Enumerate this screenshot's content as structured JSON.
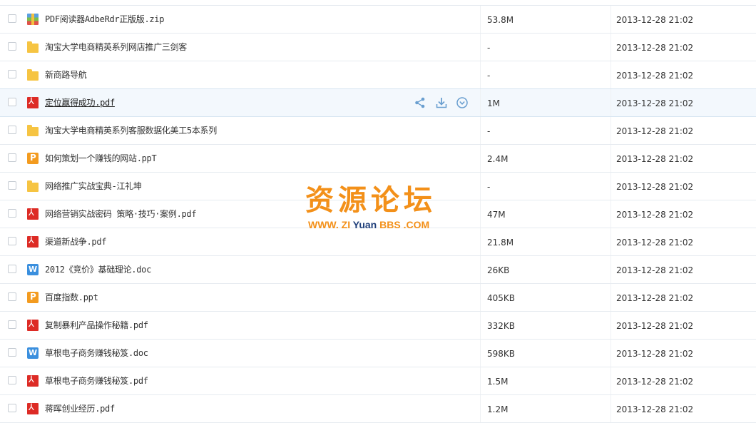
{
  "files": [
    {
      "name": "PDF阅读器AdbeRdr正版版.zip",
      "type": "zip",
      "size": "53.8M",
      "date": "2013-12-28 21:02"
    },
    {
      "name": "淘宝大学电商精英系列网店推广三剑客",
      "type": "folder",
      "size": "-",
      "date": "2013-12-28 21:02"
    },
    {
      "name": "新商路导航",
      "type": "folder",
      "size": "-",
      "date": "2013-12-28 21:02"
    },
    {
      "name": "定位赢得成功.pdf",
      "type": "pdf",
      "size": "1M",
      "date": "2013-12-28 21:02",
      "hover": true
    },
    {
      "name": "淘宝大学电商精英系列客服数据化美工5本系列",
      "type": "folder",
      "size": "-",
      "date": "2013-12-28 21:02"
    },
    {
      "name": "如何策划一个赚钱的网站.ppT",
      "type": "ppt",
      "size": "2.4M",
      "date": "2013-12-28 21:02"
    },
    {
      "name": "网络推广实战宝典-江礼坤",
      "type": "folder",
      "size": "-",
      "date": "2013-12-28 21:02"
    },
    {
      "name": "网络营销实战密码 策略·技巧·案例.pdf",
      "type": "pdf",
      "size": "47M",
      "date": "2013-12-28 21:02"
    },
    {
      "name": "渠道新战争.pdf",
      "type": "pdf",
      "size": "21.8M",
      "date": "2013-12-28 21:02"
    },
    {
      "name": "2012《竞价》基础理论.doc",
      "type": "doc",
      "size": "26KB",
      "date": "2013-12-28 21:02"
    },
    {
      "name": "百度指数.ppt",
      "type": "ppt",
      "size": "405KB",
      "date": "2013-12-28 21:02"
    },
    {
      "name": "复制暴利产品操作秘籍.pdf",
      "type": "pdf",
      "size": "332KB",
      "date": "2013-12-28 21:02"
    },
    {
      "name": "草根电子商务赚钱秘笈.doc",
      "type": "doc",
      "size": "598KB",
      "date": "2013-12-28 21:02"
    },
    {
      "name": "草根电子商务赚钱秘笈.pdf",
      "type": "pdf",
      "size": "1.5M",
      "date": "2013-12-28 21:02"
    },
    {
      "name": "蒋晖创业经历.pdf",
      "type": "pdf",
      "size": "1.2M",
      "date": "2013-12-28 21:02"
    }
  ],
  "row_actions": {
    "share_icon": "share-icon",
    "download_icon": "download-icon",
    "more_icon": "chevron-down-circle-icon"
  },
  "watermark": {
    "cn": "资源论坛",
    "en_prefix": "WWW.",
    "en_zi": "ZI",
    "en_yuan": "Yuan",
    "en_bbs": "BBS",
    ".com": ".COM"
  },
  "colors": {
    "accent": "#3a8fde",
    "folder": "#f6c442",
    "pdf": "#dd2b25",
    "ppt": "#f39b1f",
    "watermark": "#f39019"
  }
}
